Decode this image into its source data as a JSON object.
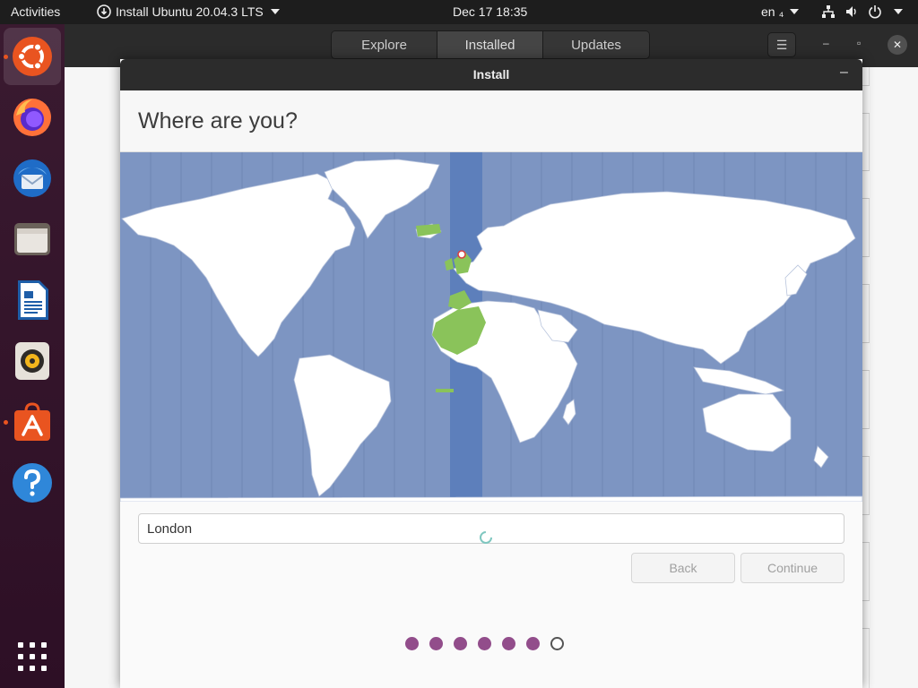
{
  "topbar": {
    "activities": "Activities",
    "app_menu": "Install Ubuntu 20.04.3 LTS",
    "clock": "Dec 17  18:35",
    "language": "en"
  },
  "dock": {
    "items": [
      {
        "name": "ubuntu-installer-icon",
        "active": true,
        "running": true
      },
      {
        "name": "firefox-icon",
        "active": false,
        "running": false
      },
      {
        "name": "thunderbird-icon",
        "active": false,
        "running": false
      },
      {
        "name": "files-icon",
        "active": false,
        "running": false
      },
      {
        "name": "libreoffice-writer-icon",
        "active": false,
        "running": false
      },
      {
        "name": "rhythmbox-icon",
        "active": false,
        "running": false
      },
      {
        "name": "ubuntu-software-icon",
        "active": false,
        "running": true
      },
      {
        "name": "help-icon",
        "active": false,
        "running": false
      }
    ],
    "show_apps": "apps-grid-icon"
  },
  "software_window": {
    "tabs": [
      "Explore",
      "Installed",
      "Updates"
    ],
    "selected_tab": "Installed"
  },
  "dialog": {
    "title": "Install",
    "heading": "Where are you?",
    "timezone_value": "London",
    "selected_city": "London",
    "back_label": "Back",
    "continue_label": "Continue",
    "progress": {
      "total": 7,
      "completed": 6
    }
  },
  "colors": {
    "ocean": "#7d95c2",
    "timezone_band": "#5d7fbb",
    "land": "#ffffff",
    "timezone_highlight": "#8ac35a",
    "accent": "#e95420",
    "progress_dot": "#924d8b"
  }
}
